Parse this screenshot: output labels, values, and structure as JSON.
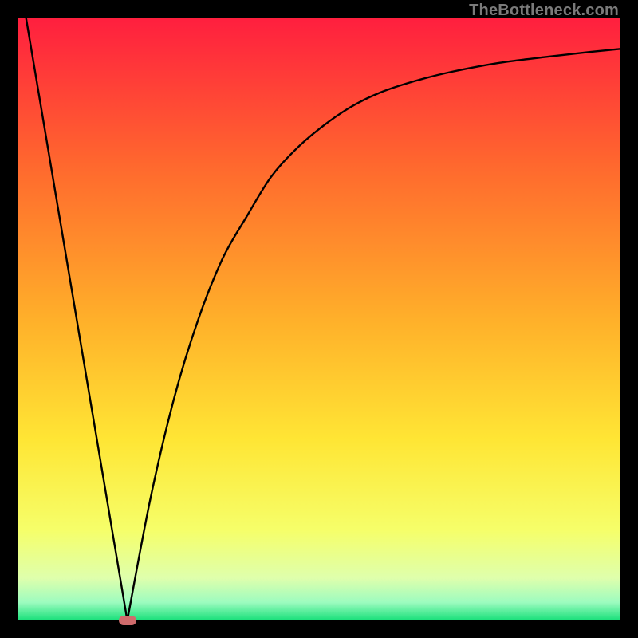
{
  "watermark": "TheBottleneck.com",
  "colors": {
    "background": "#000000",
    "gradient_stops": [
      {
        "pos": 0.0,
        "color": "#ff1f3f"
      },
      {
        "pos": 0.25,
        "color": "#ff6a2e"
      },
      {
        "pos": 0.5,
        "color": "#ffb02a"
      },
      {
        "pos": 0.7,
        "color": "#ffe635"
      },
      {
        "pos": 0.85,
        "color": "#f6ff6a"
      },
      {
        "pos": 0.93,
        "color": "#dfffad"
      },
      {
        "pos": 0.97,
        "color": "#9dfcc0"
      },
      {
        "pos": 1.0,
        "color": "#18e07a"
      }
    ],
    "curve": "#000000",
    "marker": "#cf6b6c"
  },
  "chart_data": {
    "type": "line",
    "title": "",
    "xlabel": "",
    "ylabel": "",
    "xlim": [
      0,
      1
    ],
    "ylim": [
      0,
      1
    ],
    "left_line": {
      "x": [
        0.014,
        0.182
      ],
      "y": [
        1.0,
        0.0
      ]
    },
    "right_curve": {
      "x": [
        0.182,
        0.22,
        0.26,
        0.3,
        0.34,
        0.38,
        0.42,
        0.46,
        0.5,
        0.55,
        0.6,
        0.66,
        0.72,
        0.8,
        0.88,
        0.95,
        1.0
      ],
      "y": [
        0.0,
        0.2,
        0.37,
        0.5,
        0.6,
        0.67,
        0.735,
        0.78,
        0.815,
        0.85,
        0.875,
        0.895,
        0.91,
        0.925,
        0.935,
        0.943,
        0.948
      ]
    },
    "minimum_marker": {
      "x": 0.182,
      "y": 0.0
    }
  }
}
